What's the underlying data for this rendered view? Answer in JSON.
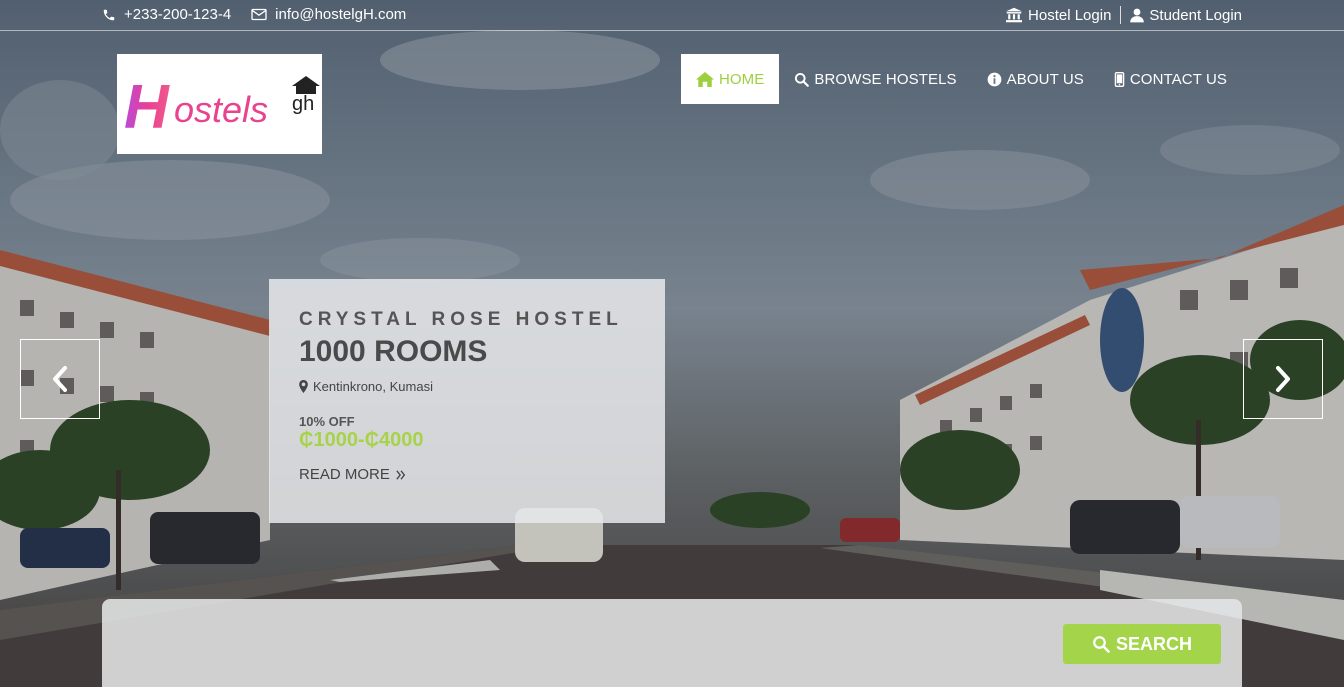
{
  "topbar": {
    "phone": "+233-200-123-4",
    "email": "info@hostelgH.com",
    "hostel_login": "Hostel Login",
    "student_login": "Student Login"
  },
  "logo": {
    "text": "Hostels",
    "suffix": "gh"
  },
  "nav": {
    "items": [
      {
        "label": "HOME",
        "icon": "home-icon",
        "active": true
      },
      {
        "label": "BROWSE HOSTELS",
        "icon": "search-icon",
        "active": false
      },
      {
        "label": "ABOUT US",
        "icon": "info-icon",
        "active": false
      },
      {
        "label": "CONTACT US",
        "icon": "mobile-icon",
        "active": false
      }
    ]
  },
  "slide": {
    "hostel_name": "CRYSTAL ROSE HOSTEL",
    "rooms": "1000 ROOMS",
    "location": "Kentinkrono, Kumasi",
    "discount": "10% OFF",
    "price": "₵1000-₵4000",
    "read_more": "READ MORE"
  },
  "search": {
    "button_label": "SEARCH"
  },
  "colors": {
    "accent": "#a4d449",
    "nav_active": "#9dcf3f"
  }
}
